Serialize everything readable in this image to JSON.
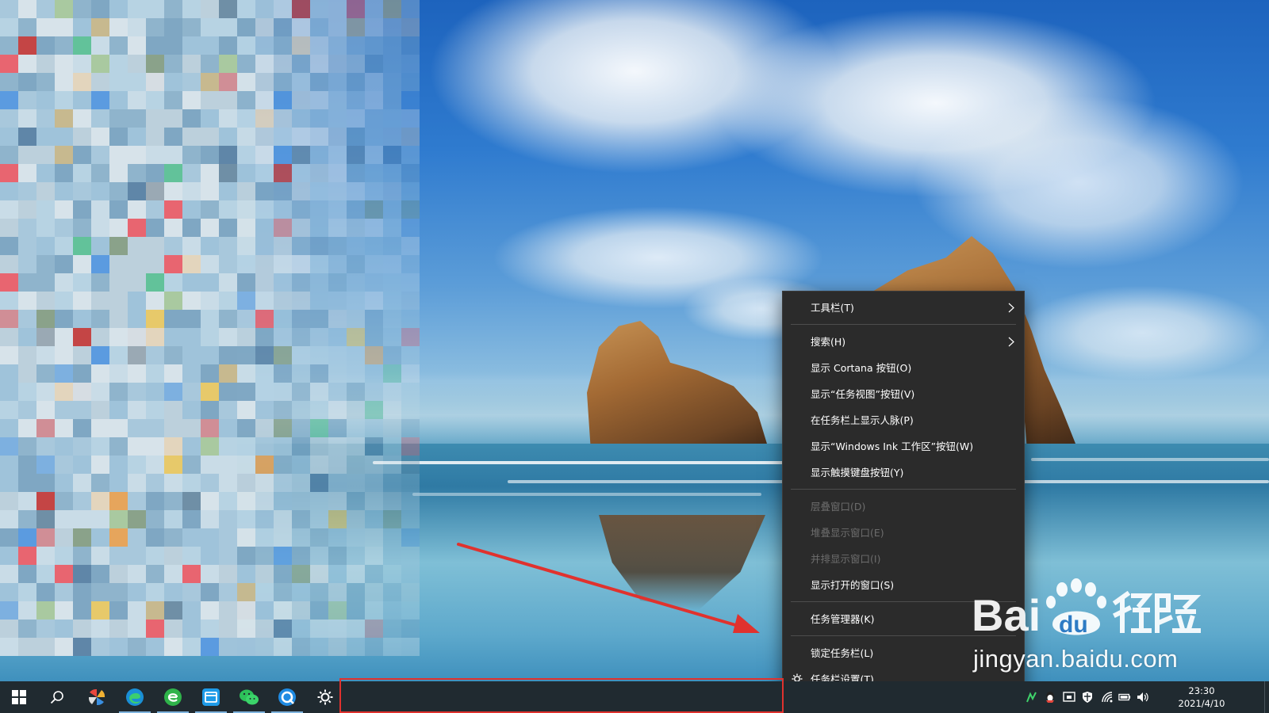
{
  "context_menu": {
    "items": [
      {
        "label": "工具栏(T)",
        "submenu": true,
        "enabled": true
      },
      {
        "label": "搜索(H)",
        "submenu": true,
        "enabled": true
      },
      {
        "label": "显示 Cortana 按钮(O)",
        "enabled": true
      },
      {
        "label": "显示“任务视图”按钮(V)",
        "enabled": true
      },
      {
        "label": "在任务栏上显示人脉(P)",
        "enabled": true
      },
      {
        "label": "显示“Windows Ink 工作区”按钮(W)",
        "enabled": true
      },
      {
        "label": "显示触摸键盘按钮(Y)",
        "enabled": true
      },
      {
        "label": "层叠窗口(D)",
        "enabled": false
      },
      {
        "label": "堆叠显示窗口(E)",
        "enabled": false
      },
      {
        "label": "并排显示窗口(I)",
        "enabled": false
      },
      {
        "label": "显示打开的窗口(S)",
        "enabled": true
      },
      {
        "label": "任务管理器(K)",
        "enabled": true
      },
      {
        "label": "锁定任务栏(L)",
        "enabled": true
      },
      {
        "label": "任务栏设置(T)",
        "enabled": true,
        "icon": "gear-icon"
      }
    ]
  },
  "taskbar": {
    "buttons": [
      {
        "name": "start-button",
        "icon": "windows-logo-icon"
      },
      {
        "name": "search-button",
        "icon": "search-icon"
      },
      {
        "name": "app-pinwheel",
        "icon": "pinwheel-app-icon"
      },
      {
        "name": "edge-browser",
        "icon": "edge-icon"
      },
      {
        "name": "browser-360",
        "icon": "globe-e-icon"
      },
      {
        "name": "app-blue-window",
        "icon": "blue-window-icon"
      },
      {
        "name": "wechat",
        "icon": "wechat-icon"
      },
      {
        "name": "app-q-browser",
        "icon": "q-browser-icon"
      },
      {
        "name": "settings",
        "icon": "gear-icon"
      }
    ],
    "tray_icons": [
      "network-activity-icon",
      "qq-icon",
      "security-center-icon",
      "shield-icon",
      "wifi-icon",
      "battery-icon",
      "volume-icon"
    ],
    "clock": {
      "time": "23:30",
      "date": "2021/4/10"
    }
  },
  "watermark": {
    "brand": "Baidu经验",
    "url": "jingyan.baidu.com"
  },
  "colors": {
    "menu_bg": "#2b2b2b",
    "menu_text": "#ffffff",
    "menu_disabled_text": "#6d6d6d",
    "taskbar_bg": "#202a30",
    "annotation_red": "#e0322e"
  }
}
